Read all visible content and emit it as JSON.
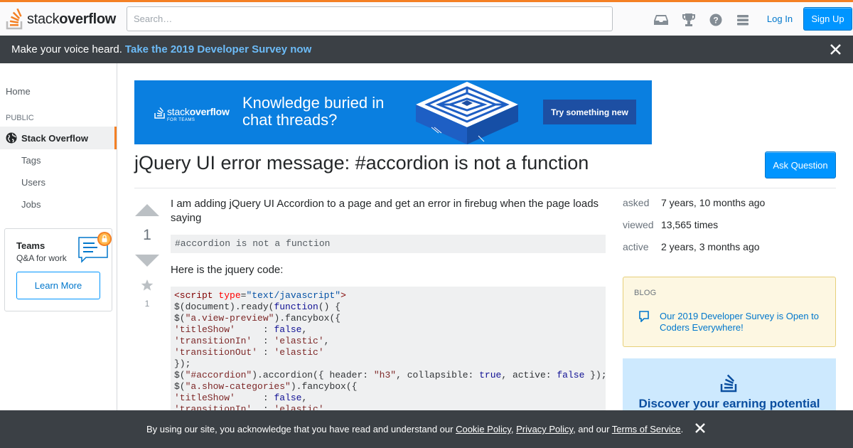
{
  "header": {
    "logo_prefix": "stack",
    "logo_suffix": "overflow",
    "search_placeholder": "Search…",
    "login_label": "Log In",
    "signup_label": "Sign Up",
    "icons": [
      "inbox-icon",
      "achievements-icon",
      "help-icon",
      "site-switcher-icon"
    ]
  },
  "survey_banner": {
    "text": "Make your voice heard.",
    "link": "Take the 2019 Developer Survey now"
  },
  "sidebar": {
    "home": "Home",
    "public_heading": "PUBLIC",
    "active_item": "Stack Overflow",
    "items": [
      "Tags",
      "Users",
      "Jobs"
    ],
    "teams": {
      "title": "Teams",
      "subtitle": "Q&A for work",
      "button": "Learn More"
    }
  },
  "ad": {
    "logo_prefix": "stack",
    "logo_suffix": "overflow",
    "logo_sub": "FOR TEAMS",
    "headline": "Knowledge buried in chat threads?",
    "cta": "Try something new"
  },
  "question": {
    "title": "jQuery UI error message: #accordion is not a function",
    "ask_button": "Ask Question",
    "votes": "1",
    "favorites": "1",
    "body_intro": "I am adding jQuery UI Accordion to a page and get an error in firebug when the page loads saying",
    "error_code": "#accordion is not a function",
    "body_code_intro": "Here is the jquery code:",
    "code_lines": [
      "<script type=\"text/javascript\">",
      "$(document).ready(function() {",
      "$(\"a.view-preview\").fancybox({",
      "'titleShow'     : false,",
      "'transitionIn'  : 'elastic',",
      "'transitionOut' : 'elastic'",
      "});",
      "$(\"#accordion\").accordion({ header: \"h3\", collapsible: true, active: false });",
      "$(\"a.show-categories\").fancybox({",
      "'titleShow'     : false,",
      "'transitionIn'  : 'elastic',"
    ]
  },
  "stats": {
    "asked_label": "asked",
    "asked_value": "7 years, 10 months ago",
    "viewed_label": "viewed",
    "viewed_value": "13,565 times",
    "active_label": "active",
    "active_value": "2 years, 3 months ago"
  },
  "blog": {
    "heading": "BLOG",
    "link": "Our 2019 Developer Survey is Open to Coders Everywhere!"
  },
  "earn_ad": {
    "text": "Discover your earning potential"
  },
  "cookie": {
    "prefix": "By using our site, you acknowledge that you have read and understand our",
    "cookie_policy": "Cookie Policy",
    "sep1": ",",
    "privacy_policy": "Privacy Policy",
    "sep2": ", and our",
    "terms": "Terms of Service",
    "suffix": "."
  },
  "colors": {
    "accent_orange": "#f48024",
    "primary_blue": "#0095ff",
    "link_blue": "#0077cc",
    "banner_dark": "#3b4045"
  }
}
